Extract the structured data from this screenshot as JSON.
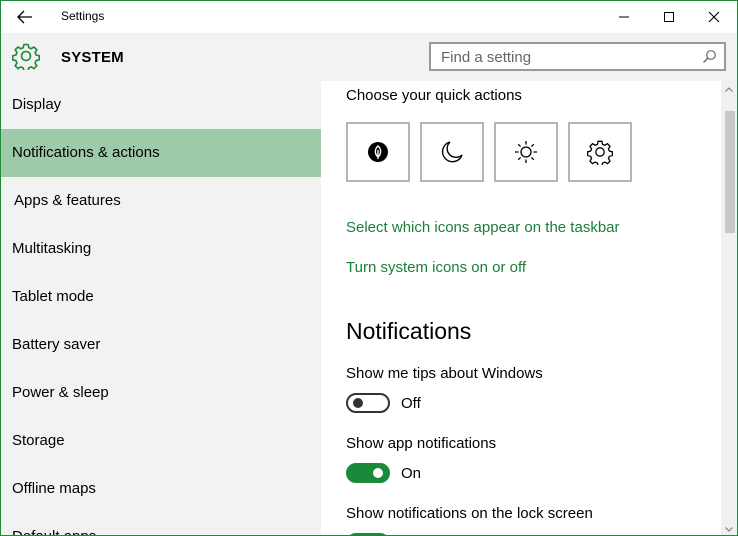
{
  "window": {
    "title": "Settings"
  },
  "header": {
    "title": "SYSTEM",
    "search_placeholder": "Find a setting"
  },
  "sidebar": {
    "items": [
      {
        "label": "Display"
      },
      {
        "label": "Notifications & actions"
      },
      {
        "label": "Apps & features"
      },
      {
        "label": "Multitasking"
      },
      {
        "label": "Tablet mode"
      },
      {
        "label": "Battery saver"
      },
      {
        "label": "Power & sleep"
      },
      {
        "label": "Storage"
      },
      {
        "label": "Offline maps"
      },
      {
        "label": "Default apps"
      }
    ],
    "active_item": "Notifications & actions"
  },
  "content": {
    "quick_actions_title": "Choose your quick actions",
    "quick_actions": [
      {
        "icon": "battery-saver-icon"
      },
      {
        "icon": "quiet-hours-moon-icon"
      },
      {
        "icon": "brightness-sun-icon"
      },
      {
        "icon": "settings-gear-icon"
      }
    ],
    "link_taskbar_icons": "Select which icons appear on the taskbar",
    "link_system_icons": "Turn system icons on or off",
    "notifications_title": "Notifications",
    "settings": [
      {
        "label": "Show me tips about Windows",
        "state": "Off"
      },
      {
        "label": "Show app notifications",
        "state": "On"
      },
      {
        "label": "Show notifications on the lock screen",
        "state": "On"
      }
    ]
  },
  "colors": {
    "accent": "#1a8a3a",
    "active_nav": "#9dcaa8",
    "link": "#1a7f37",
    "sidebar_bg": "#f2f2f2"
  }
}
